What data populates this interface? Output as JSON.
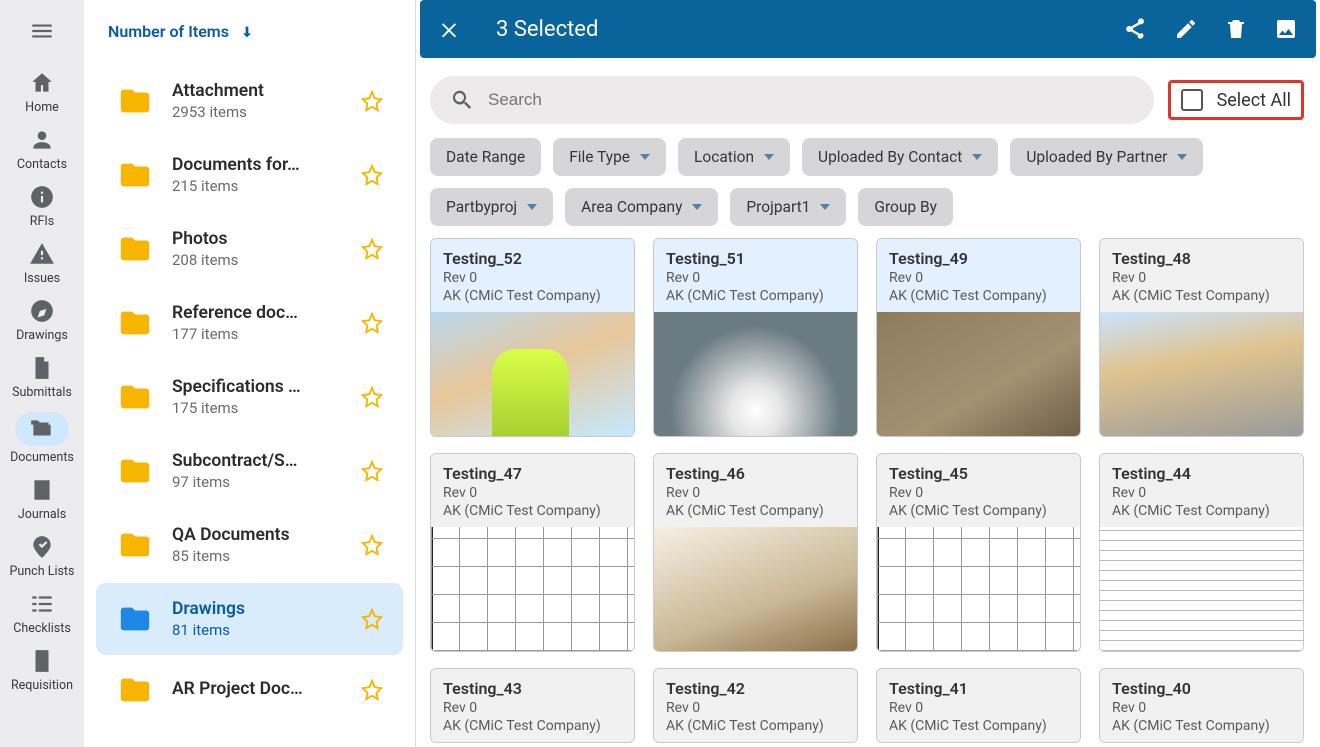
{
  "rail": {
    "items": [
      {
        "icon": "home",
        "label": "Home"
      },
      {
        "icon": "person",
        "label": "Contacts"
      },
      {
        "icon": "info",
        "label": "RFIs"
      },
      {
        "icon": "warning",
        "label": "Issues"
      },
      {
        "icon": "compass",
        "label": "Drawings"
      },
      {
        "icon": "file",
        "label": "Submittals"
      },
      {
        "icon": "folders",
        "label": "Documents",
        "active": true
      },
      {
        "icon": "journal",
        "label": "Journals"
      },
      {
        "icon": "punch",
        "label": "Punch Lists"
      },
      {
        "icon": "checklist",
        "label": "Checklists"
      },
      {
        "icon": "requisition",
        "label": "Requisition"
      }
    ]
  },
  "folder_header": {
    "label": "Number of Items"
  },
  "folders": [
    {
      "name": "Attachment",
      "count": "2953 items"
    },
    {
      "name": "Documents for…",
      "count": "215 items"
    },
    {
      "name": "Photos",
      "count": "208 items"
    },
    {
      "name": "Reference doc…",
      "count": "177 items"
    },
    {
      "name": "Specifications …",
      "count": "175 items"
    },
    {
      "name": "Subcontract/S…",
      "count": "97 items"
    },
    {
      "name": "QA Documents",
      "count": "85 items"
    },
    {
      "name": "Drawings",
      "count": "81 items",
      "active": true
    },
    {
      "name": "AR Project Doc…",
      "count": ""
    }
  ],
  "selection_bar": {
    "title": "3 Selected"
  },
  "search": {
    "placeholder": "Search"
  },
  "select_all": {
    "label": "Select All"
  },
  "chips": [
    {
      "label": "Date Range",
      "dropdown": false
    },
    {
      "label": "File Type",
      "dropdown": true
    },
    {
      "label": "Location",
      "dropdown": true
    },
    {
      "label": "Uploaded By Contact",
      "dropdown": true
    },
    {
      "label": "Uploaded By Partner",
      "dropdown": true
    },
    {
      "label": "Partbyproj",
      "dropdown": true
    },
    {
      "label": "Area Company",
      "dropdown": true
    },
    {
      "label": "Projpart1",
      "dropdown": true
    },
    {
      "label": "Group By",
      "dropdown": false
    }
  ],
  "cards": [
    {
      "title": "Testing_52",
      "rev": "Rev 0",
      "company": "AK (CMiC Test Company)",
      "selected": true,
      "thumb": "t-photo1"
    },
    {
      "title": "Testing_51",
      "rev": "Rev 0",
      "company": "AK (CMiC Test Company)",
      "selected": true,
      "thumb": "t-photo2"
    },
    {
      "title": "Testing_49",
      "rev": "Rev 0",
      "company": "AK (CMiC Test Company)",
      "selected": true,
      "thumb": "t-photo3"
    },
    {
      "title": "Testing_48",
      "rev": "Rev 0",
      "company": "AK (CMiC Test Company)",
      "selected": false,
      "thumb": "t-photo4"
    },
    {
      "title": "Testing_47",
      "rev": "Rev 0",
      "company": "AK (CMiC Test Company)",
      "selected": false,
      "thumb": "t-plan"
    },
    {
      "title": "Testing_46",
      "rev": "Rev 0",
      "company": "AK (CMiC Test Company)",
      "selected": false,
      "thumb": "t-render"
    },
    {
      "title": "Testing_45",
      "rev": "Rev 0",
      "company": "AK (CMiC Test Company)",
      "selected": false,
      "thumb": "t-plan"
    },
    {
      "title": "Testing_44",
      "rev": "Rev 0",
      "company": "AK (CMiC Test Company)",
      "selected": false,
      "thumb": "t-doc"
    },
    {
      "title": "Testing_43",
      "rev": "Rev 0",
      "company": "AK (CMiC Test Company)",
      "selected": false,
      "truncated": true
    },
    {
      "title": "Testing_42",
      "rev": "Rev 0",
      "company": "AK (CMiC Test Company)",
      "selected": false,
      "truncated": true
    },
    {
      "title": "Testing_41",
      "rev": "Rev 0",
      "company": "AK (CMiC Test Company)",
      "selected": false,
      "truncated": true
    },
    {
      "title": "Testing_40",
      "rev": "Rev 0",
      "company": "AK (CMiC Test Company)",
      "selected": false,
      "truncated": true
    }
  ]
}
